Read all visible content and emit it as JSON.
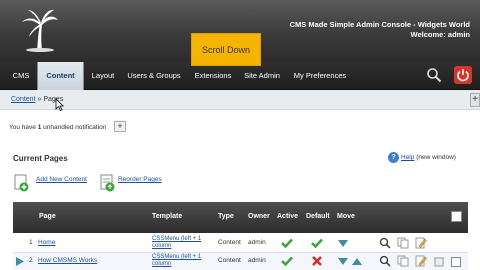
{
  "header": {
    "title": "CMS Made Simple Admin Console - Widgets World",
    "welcome": "Welcome: admin"
  },
  "tooltip": {
    "text": "Scroll Down"
  },
  "nav": {
    "items": [
      {
        "label": "CMS"
      },
      {
        "label": "Content"
      },
      {
        "label": "Layout"
      },
      {
        "label": "Users & Groups"
      },
      {
        "label": "Extensions"
      },
      {
        "label": "Site Admin"
      },
      {
        "label": "My Preferences"
      }
    ],
    "icons": {
      "search": "search-icon",
      "logout": "power-icon"
    },
    "logout_color": "#d9362b"
  },
  "breadcrumb": {
    "root": "Content",
    "separator": "»",
    "current": "Pages"
  },
  "notification": {
    "prefix": "You have ",
    "count": "1",
    "suffix": " unhandled notification"
  },
  "page": {
    "section_title": "Current Pages",
    "help_label": "Help",
    "help_note": "(new window)"
  },
  "actions": {
    "add": "Add New Content",
    "reorder": "Reorder Pages"
  },
  "table": {
    "columns": [
      "Page",
      "Template",
      "Type",
      "Owner",
      "Active",
      "Default",
      "Move"
    ],
    "rows": [
      {
        "num": "1",
        "page": "Home",
        "template": "CSSMenu (left + 1 column",
        "type": "Content",
        "owner": "admin",
        "active": "yes",
        "default": "yes"
      },
      {
        "num": "2",
        "page": "How CMSMS Works",
        "template": "CSSMenu (left + 1 column",
        "type": "Content",
        "owner": "admin",
        "active": "yes",
        "default": "no"
      }
    ]
  },
  "colors": {
    "accent": "#f5b400",
    "link": "#1d4f9c",
    "header_dark": "#2c2c2c",
    "check_green": "#3aa43a",
    "cross_red": "#d52b2b"
  }
}
